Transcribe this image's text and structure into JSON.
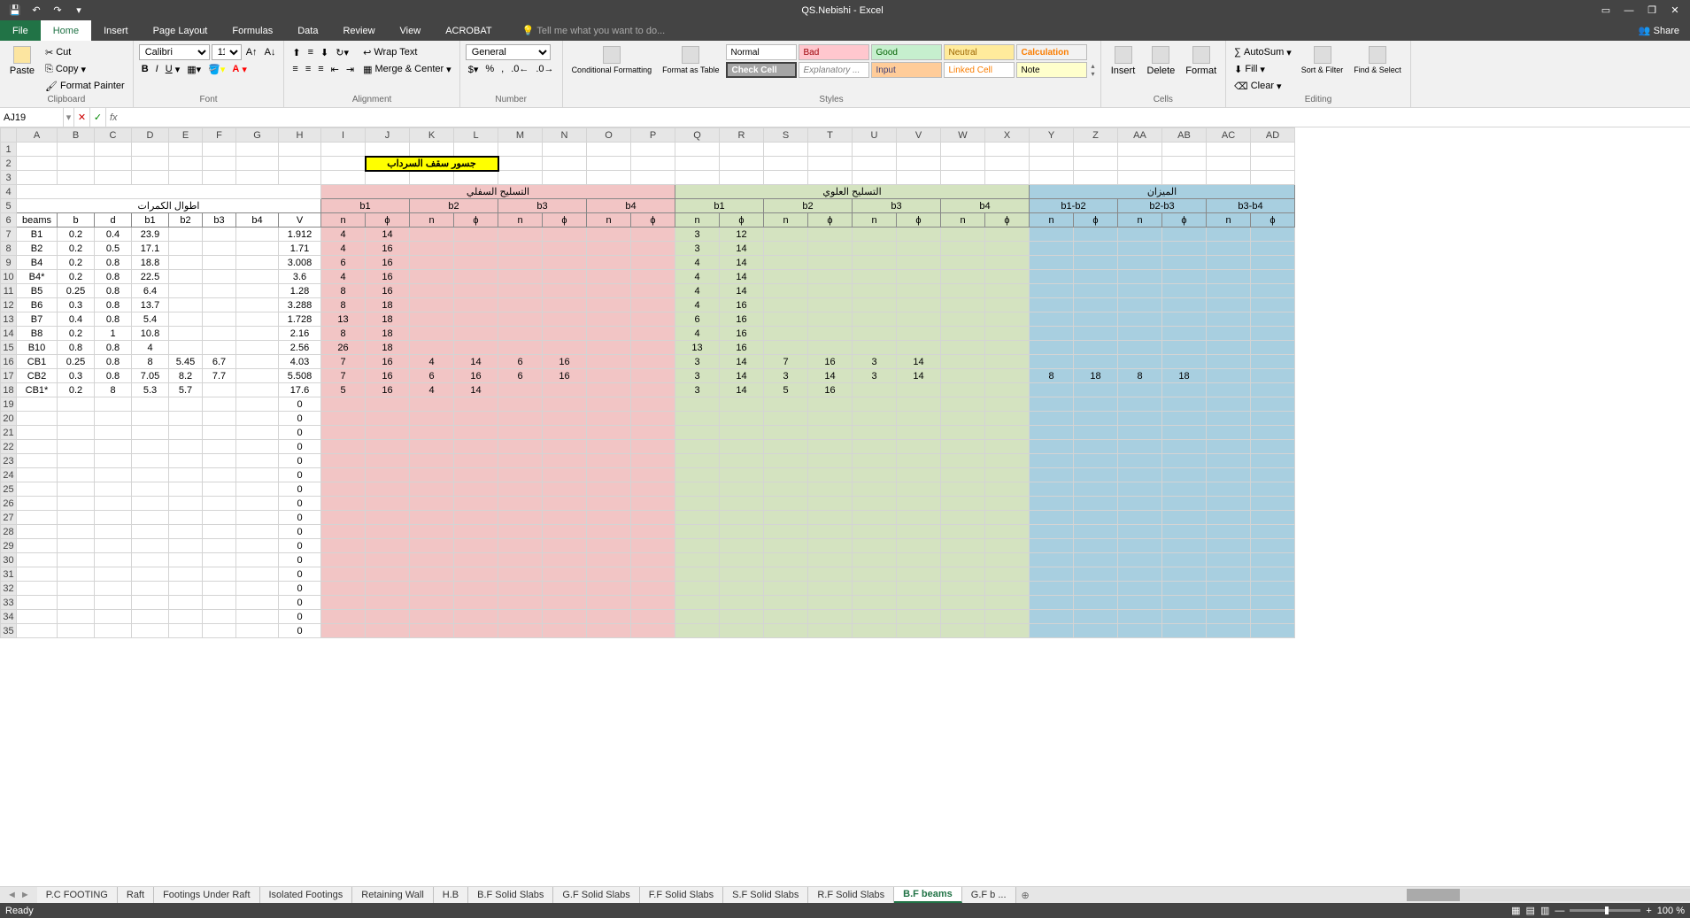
{
  "title": "QS.Nebishi - Excel",
  "ribbon_tabs": [
    "File",
    "Home",
    "Insert",
    "Page Layout",
    "Formulas",
    "Data",
    "Review",
    "View",
    "ACROBAT"
  ],
  "tell_me": "Tell me what you want to do...",
  "share": "Share",
  "clipboard": {
    "paste": "Paste",
    "cut": "Cut",
    "copy": "Copy",
    "painter": "Format Painter",
    "label": "Clipboard"
  },
  "font": {
    "name": "Calibri",
    "size": "11",
    "label": "Font"
  },
  "alignment": {
    "wrap": "Wrap Text",
    "merge": "Merge & Center",
    "label": "Alignment"
  },
  "number": {
    "format": "General",
    "label": "Number"
  },
  "styles": {
    "cond": "Conditional Formatting",
    "fmtas": "Format as Table",
    "label": "Styles",
    "cells": [
      "Normal",
      "Bad",
      "Good",
      "Neutral",
      "Calculation",
      "Check Cell",
      "Explanatory ...",
      "Input",
      "Linked Cell",
      "Note"
    ]
  },
  "cells": {
    "insert": "Insert",
    "delete": "Delete",
    "format": "Format",
    "label": "Cells"
  },
  "editing": {
    "autosum": "AutoSum",
    "fill": "Fill",
    "clear": "Clear",
    "sort": "Sort & Filter",
    "find": "Find & Select",
    "label": "Editing"
  },
  "namebox": "AJ19",
  "sheet_tabs": [
    "P.C FOOTING",
    "Raft",
    "Footings Under Raft",
    "Isolated Footings",
    "Retaining Wall",
    "H.B",
    "B.F Solid Slabs",
    "G.F Solid Slabs",
    "F.F Solid Slabs",
    "S.F Solid Slabs",
    "R.F Solid Slabs",
    "B.F beams",
    "G.F b ..."
  ],
  "active_sheet": 11,
  "status": "Ready",
  "zoom": "100 %",
  "columns": [
    "A",
    "B",
    "C",
    "D",
    "E",
    "F",
    "G",
    "H",
    "I",
    "J",
    "K",
    "L",
    "M",
    "N",
    "O",
    "P",
    "Q",
    "R",
    "S",
    "T",
    "U",
    "V",
    "W",
    "X",
    "Y",
    "Z",
    "AA",
    "AB",
    "AC",
    "AD"
  ],
  "merged_title": "جسور سقف السرداب",
  "section_hdr1": "اطوال الكمرات",
  "section_hdr2": "التسليح السفلي",
  "section_hdr3": "التسليح العلوي",
  "section_hdr4": "الميزان",
  "sub_b": [
    "b1",
    "b2",
    "b3",
    "b4"
  ],
  "sub_balance": [
    "b1-b2",
    "b2-b3",
    "b3-b4"
  ],
  "colnames": {
    "beams": "beams",
    "b": "b",
    "d": "d",
    "b1": "b1",
    "b2": "b2",
    "b3": "b3",
    "b4": "b4",
    "V": "V",
    "n": "n",
    "phi": "ϕ"
  },
  "rows": [
    {
      "r": 7,
      "beam": "B1",
      "b": "0.2",
      "d": "0.4",
      "b1": "23.9",
      "V": "1.912",
      "I": "4",
      "J": "14",
      "Q": "3",
      "R": "12"
    },
    {
      "r": 8,
      "beam": "B2",
      "b": "0.2",
      "d": "0.5",
      "b1": "17.1",
      "V": "1.71",
      "I": "4",
      "J": "16",
      "Q": "3",
      "R": "14"
    },
    {
      "r": 9,
      "beam": "B4",
      "b": "0.2",
      "d": "0.8",
      "b1": "18.8",
      "V": "3.008",
      "I": "6",
      "J": "16",
      "Q": "4",
      "R": "14"
    },
    {
      "r": 10,
      "beam": "B4*",
      "b": "0.2",
      "d": "0.8",
      "b1": "22.5",
      "V": "3.6",
      "I": "4",
      "J": "16",
      "Q": "4",
      "R": "14"
    },
    {
      "r": 11,
      "beam": "B5",
      "b": "0.25",
      "d": "0.8",
      "b1": "6.4",
      "V": "1.28",
      "I": "8",
      "J": "16",
      "Q": "4",
      "R": "14"
    },
    {
      "r": 12,
      "beam": "B6",
      "b": "0.3",
      "d": "0.8",
      "b1": "13.7",
      "V": "3.288",
      "I": "8",
      "J": "18",
      "Q": "4",
      "R": "16"
    },
    {
      "r": 13,
      "beam": "B7",
      "b": "0.4",
      "d": "0.8",
      "b1": "5.4",
      "V": "1.728",
      "I": "13",
      "J": "18",
      "Q": "6",
      "R": "16"
    },
    {
      "r": 14,
      "beam": "B8",
      "b": "0.2",
      "d": "1",
      "b1": "10.8",
      "V": "2.16",
      "I": "8",
      "J": "18",
      "Q": "4",
      "R": "16"
    },
    {
      "r": 15,
      "beam": "B10",
      "b": "0.8",
      "d": "0.8",
      "b1": "4",
      "V": "2.56",
      "I": "26",
      "J": "18",
      "Q": "13",
      "R": "16"
    },
    {
      "r": 16,
      "beam": "CB1",
      "b": "0.25",
      "d": "0.8",
      "b1": "8",
      "b2": "5.45",
      "b3": "6.7",
      "V": "4.03",
      "I": "7",
      "J": "16",
      "K": "4",
      "L": "14",
      "M": "6",
      "N": "16",
      "Q": "3",
      "R": "14",
      "S": "7",
      "T": "16",
      "U": "3",
      "V2": "14"
    },
    {
      "r": 17,
      "beam": "CB2",
      "b": "0.3",
      "d": "0.8",
      "b1": "7.05",
      "b2": "8.2",
      "b3": "7.7",
      "V": "5.508",
      "I": "7",
      "J": "16",
      "K": "6",
      "L": "16",
      "M": "6",
      "N": "16",
      "Q": "3",
      "R": "14",
      "S": "3",
      "T": "14",
      "U": "3",
      "V2": "14",
      "Y": "8",
      "Z": "18",
      "AA": "8",
      "AB": "18"
    },
    {
      "r": 18,
      "beam": "CB1*",
      "b": "0.2",
      "d": "8",
      "b1": "5.3",
      "b2": "5.7",
      "V": "17.6",
      "I": "5",
      "J": "16",
      "K": "4",
      "L": "14",
      "Q": "3",
      "R": "14",
      "S": "5",
      "T": "16"
    }
  ],
  "zero_rows_start": 19,
  "zero_rows_end": 35
}
